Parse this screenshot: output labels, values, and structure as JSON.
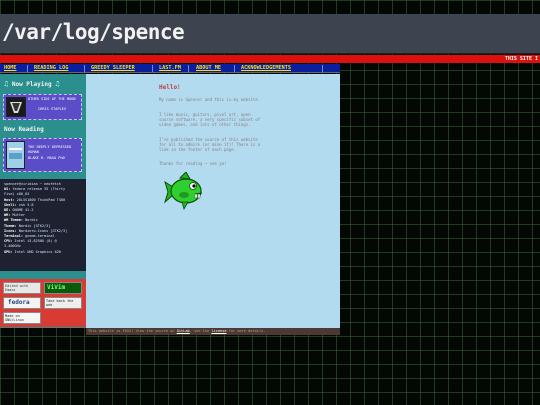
{
  "header": {
    "title": "/var/log/spence"
  },
  "marquee": {
    "text": "THIS SITE I"
  },
  "nav": {
    "items": [
      "HOME",
      "READING LOG",
      "GREEDY SLEEPER",
      "LAST.FM",
      "ABOUT ME",
      "ACKNOWLEDGEMENTS"
    ]
  },
  "sidebar": {
    "now_playing": {
      "title": "Now Playing",
      "track": "OTHER SIDE OF THE MOON",
      "artist": "CHRIS STAPLES"
    },
    "now_reading": {
      "title": "Now Reading",
      "book": "THE DEEPLY DEPRESSED HUMAN",
      "author": "BLAKE R. MAXA PhD"
    },
    "fetch": {
      "prompt": "spencer@viridian ~ neofetch",
      "lines": [
        {
          "k": "OS:",
          "v": " fedora release 35 (Thirty"
        },
        {
          "k": "",
          "v": "Five) x86_64"
        },
        {
          "k": "Host:",
          "v": " 20L5S1800 ThinkPad T480"
        },
        {
          "k": "Shell:",
          "v": " zsh 5.8"
        },
        {
          "k": "DE:",
          "v": " GNOME 41.2"
        },
        {
          "k": "WM:",
          "v": " Mutter"
        },
        {
          "k": "WM Theme:",
          "v": " Nordic"
        },
        {
          "k": "Theme:",
          "v": " Nordic [GTK2/3]"
        },
        {
          "k": "Icons:",
          "v": " Nordzero-Icons [GTK2/3]"
        },
        {
          "k": "Terminal:",
          "v": " gnome-terminal"
        },
        {
          "k": "CPU:",
          "v": " Intel i5-8250U (8) @"
        },
        {
          "k": "",
          "v": "3.400GHz"
        },
        {
          "k": "GPU:",
          "v": " Intel UHD Graphics 620"
        }
      ]
    },
    "badges": {
      "emacs": "Edited with Emacs",
      "vim": "ViVim",
      "fedora": "fedora",
      "takeback": "Take back the web",
      "gnu": "Made on GNU/Linux"
    }
  },
  "content": {
    "greeting": "Hello!",
    "p1": "My name is Spencer and this is my website.",
    "p2": "I like music, guitars, pixel art, open source software, a very specific subset of video games, and lots of other things.",
    "p3": "I've published the source of this website for all to admire (or mine it)! There is a link in the footer of each page.",
    "p4": "Thanks for reading ~ see ya!"
  },
  "footer": {
    "prefix": "This website is FOSS! View the source on ",
    "link1": "GitLab",
    "mid": ", see the ",
    "link2": "license",
    "suffix": " for more details."
  }
}
